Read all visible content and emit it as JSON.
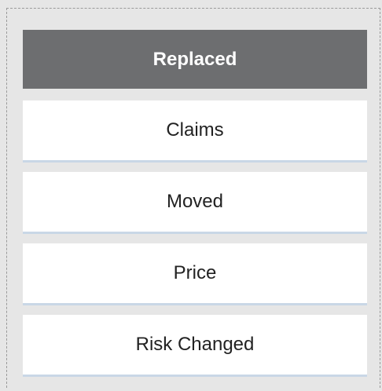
{
  "list": {
    "header_label": "Replaced",
    "items": [
      {
        "label": "Claims"
      },
      {
        "label": "Moved"
      },
      {
        "label": "Price"
      },
      {
        "label": "Risk Changed"
      }
    ]
  },
  "colors": {
    "background": "#e6e6e6",
    "header_background": "#6d6e70",
    "header_text": "#ffffff",
    "item_background": "#ffffff",
    "item_border": "#c9d7e6"
  }
}
